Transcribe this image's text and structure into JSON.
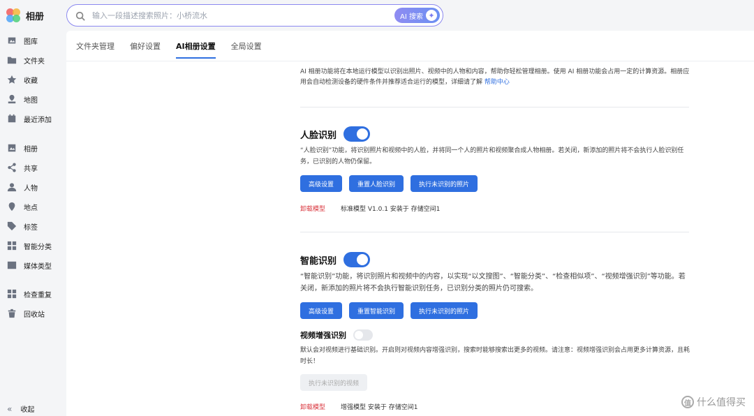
{
  "app": {
    "name": "相册",
    "logo": "flower-logo"
  },
  "search": {
    "placeholder": "输入一段描述搜索照片：小桥流水",
    "ai_label": "AI 搜索",
    "icon": "search-icon"
  },
  "sidebar": {
    "items": [
      {
        "label": "图库",
        "icon": "gallery-icon"
      },
      {
        "label": "文件夹",
        "icon": "folder-icon"
      },
      {
        "label": "收藏",
        "icon": "star-icon"
      },
      {
        "label": "地图",
        "icon": "map-icon"
      },
      {
        "label": "最近添加",
        "icon": "calendar-icon"
      },
      {
        "label": "相册",
        "icon": "album-icon"
      },
      {
        "label": "共享",
        "icon": "share-icon"
      },
      {
        "label": "人物",
        "icon": "person-icon"
      },
      {
        "label": "地点",
        "icon": "location-icon"
      },
      {
        "label": "标签",
        "icon": "tag-icon"
      },
      {
        "label": "智能分类",
        "icon": "grid-icon"
      },
      {
        "label": "媒体类型",
        "icon": "media-icon"
      },
      {
        "label": "检查重复",
        "icon": "duplicate-icon"
      },
      {
        "label": "回收站",
        "icon": "trash-icon"
      }
    ],
    "collapse_label": "收起"
  },
  "tabs": [
    {
      "label": "文件夹管理",
      "active": false
    },
    {
      "label": "偏好设置",
      "active": false
    },
    {
      "label": "AI相册设置",
      "active": true
    },
    {
      "label": "全局设置",
      "active": false
    }
  ],
  "intro": {
    "text": "AI 相册功能将在本地运行模型以识别出照片、视频中的人物和内容，帮助你轻松管理相册。使用 AI 相册功能会占用一定的计算资源。相册应用会自动检测设备的硬件条件并推荐适合运行的模型，详细请了解 ",
    "link": "帮助中心"
  },
  "face": {
    "title": "人脸识别",
    "enabled": true,
    "desc": "“人脸识别”功能，将识别照片和视频中的人脸，并将同一个人的照片和视频聚合成人物相册。若关闭，新添加的照片将不会执行人脸识别任务，已识别的人物仍保留。",
    "buttons": [
      "高级设置",
      "重置人脸识别",
      "执行未识别的照片"
    ],
    "uninstall": "卸载模型",
    "model_info": "标准模型 V1.0.1 安装于 存储空间1"
  },
  "smart": {
    "title": "智能识别",
    "enabled": true,
    "desc": "“智能识别”功能，将识别照片和视频中的内容，以实现“以文搜图”、“智能分类”、“检查相似项”、“视频增强识别”等功能。若关闭，新添加的照片将不会执行智能识别任务，已识别分类的照片仍可搜索。",
    "buttons": [
      "高级设置",
      "重置智能识别",
      "执行未识别的照片"
    ]
  },
  "video": {
    "title": "视频增强识别",
    "enabled": false,
    "desc": "默认会对视频进行基础识别。开启则对视频内容增强识别，搜索时能够搜索出更多的视频。请注意：视频增强识别会占用更多计算资源，且耗时长！",
    "button": "执行未识别的视频",
    "uninstall": "卸载模型",
    "model_info": "增强模型 安装于 存储空间1"
  },
  "watermark": "什么值得买",
  "colors": {
    "accent": "#2f6fe0",
    "danger": "#d9363e",
    "search_border": "#8b88f0"
  }
}
